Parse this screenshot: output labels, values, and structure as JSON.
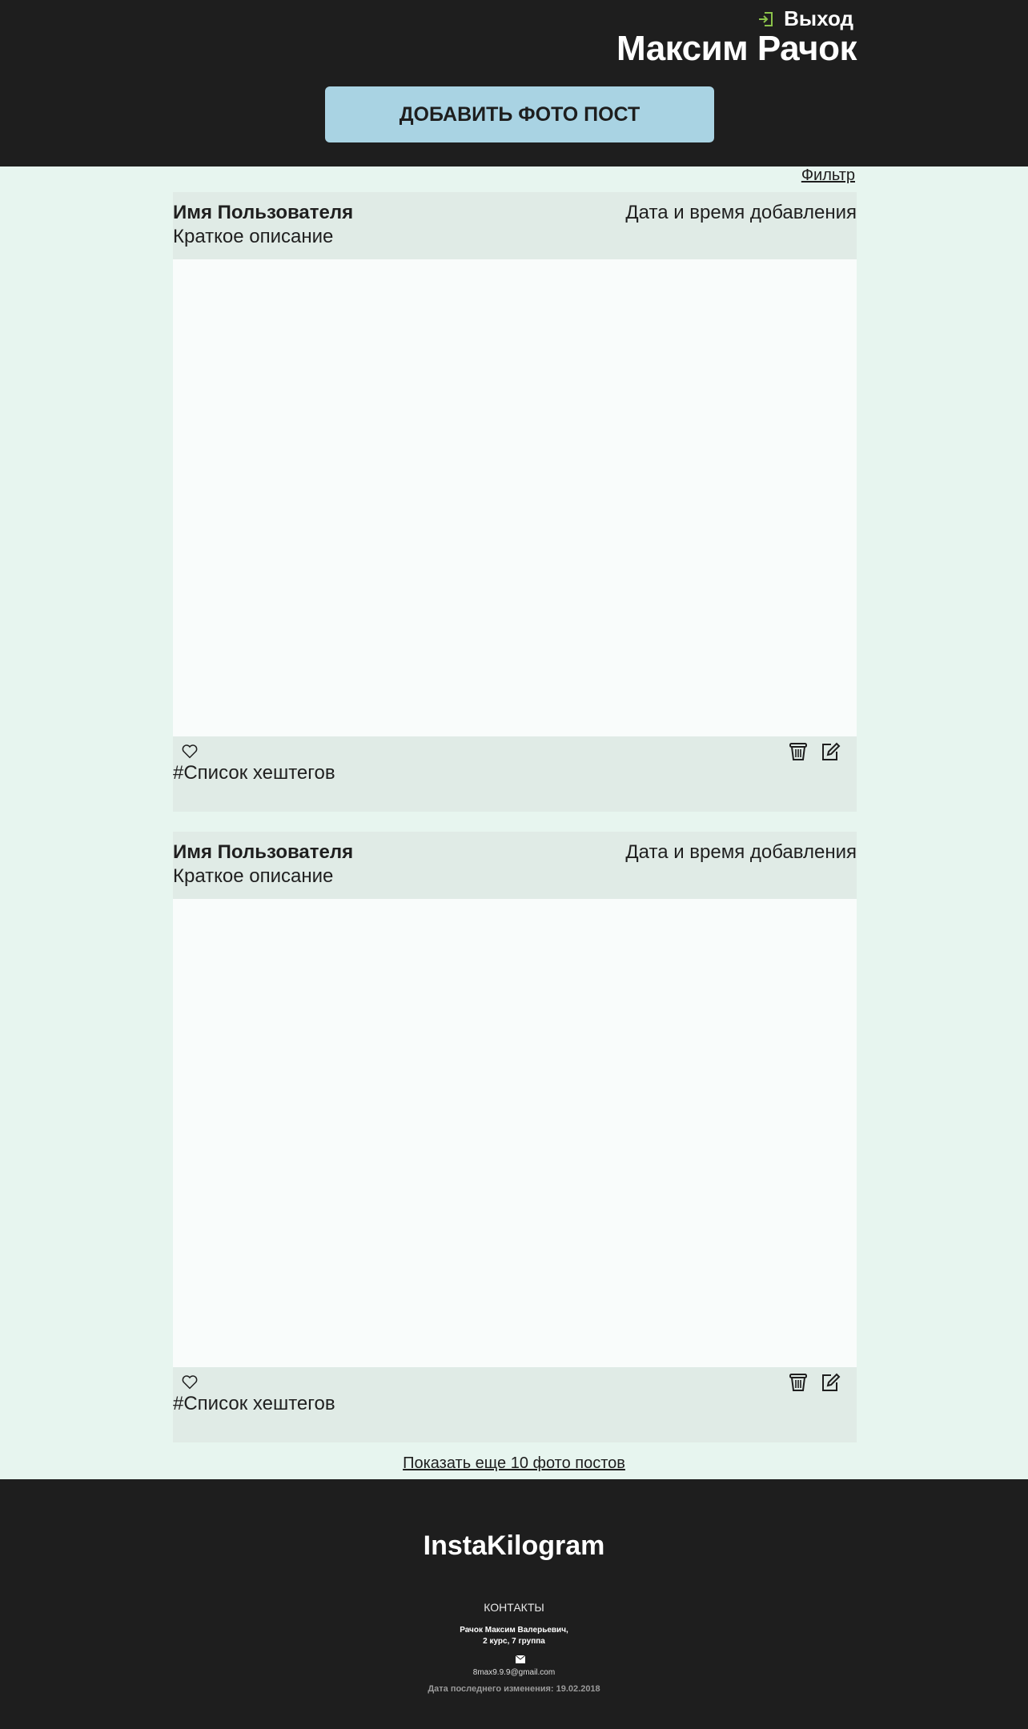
{
  "header": {
    "logout_label": "Выход",
    "user_name": "Максим Рачок",
    "add_post_label": "ДОБАВИТЬ ФОТО ПОСТ",
    "logout_icon_color": "#8bc34a"
  },
  "filter_label": "Фильтр",
  "posts": [
    {
      "user": "Имя Пользователя",
      "date": "Дата и время добавления",
      "description": "Краткое описание",
      "hashtags": "#Список хештегов"
    },
    {
      "user": "Имя Пользователя",
      "date": "Дата и время добавления",
      "description": "Краткое описание",
      "hashtags": "#Список хештегов"
    }
  ],
  "icons": {
    "like": "heart-icon",
    "delete": "trash-icon",
    "edit": "edit-icon",
    "logout": "login-arrow-icon",
    "mail": "envelope-icon"
  },
  "show_more_label": "Показать еще 10 фото постов",
  "footer": {
    "brand": "InstaKilogram",
    "contacts_title": "КОНТАКТЫ",
    "author_line1": "Рачок Максим Валерьевич,",
    "author_line2": "2 курс, 7 группа",
    "email": "8max9.9.9@gmail.com",
    "updated": "Дата последнего изменения: 19.02.2018"
  },
  "colors": {
    "header_bg": "#1e1e1e",
    "page_bg": "#e7f5ef",
    "post_bar_bg": "#e0ebe6",
    "photo_bg": "#f9fcfb",
    "add_button_bg": "#a9d3e3"
  }
}
